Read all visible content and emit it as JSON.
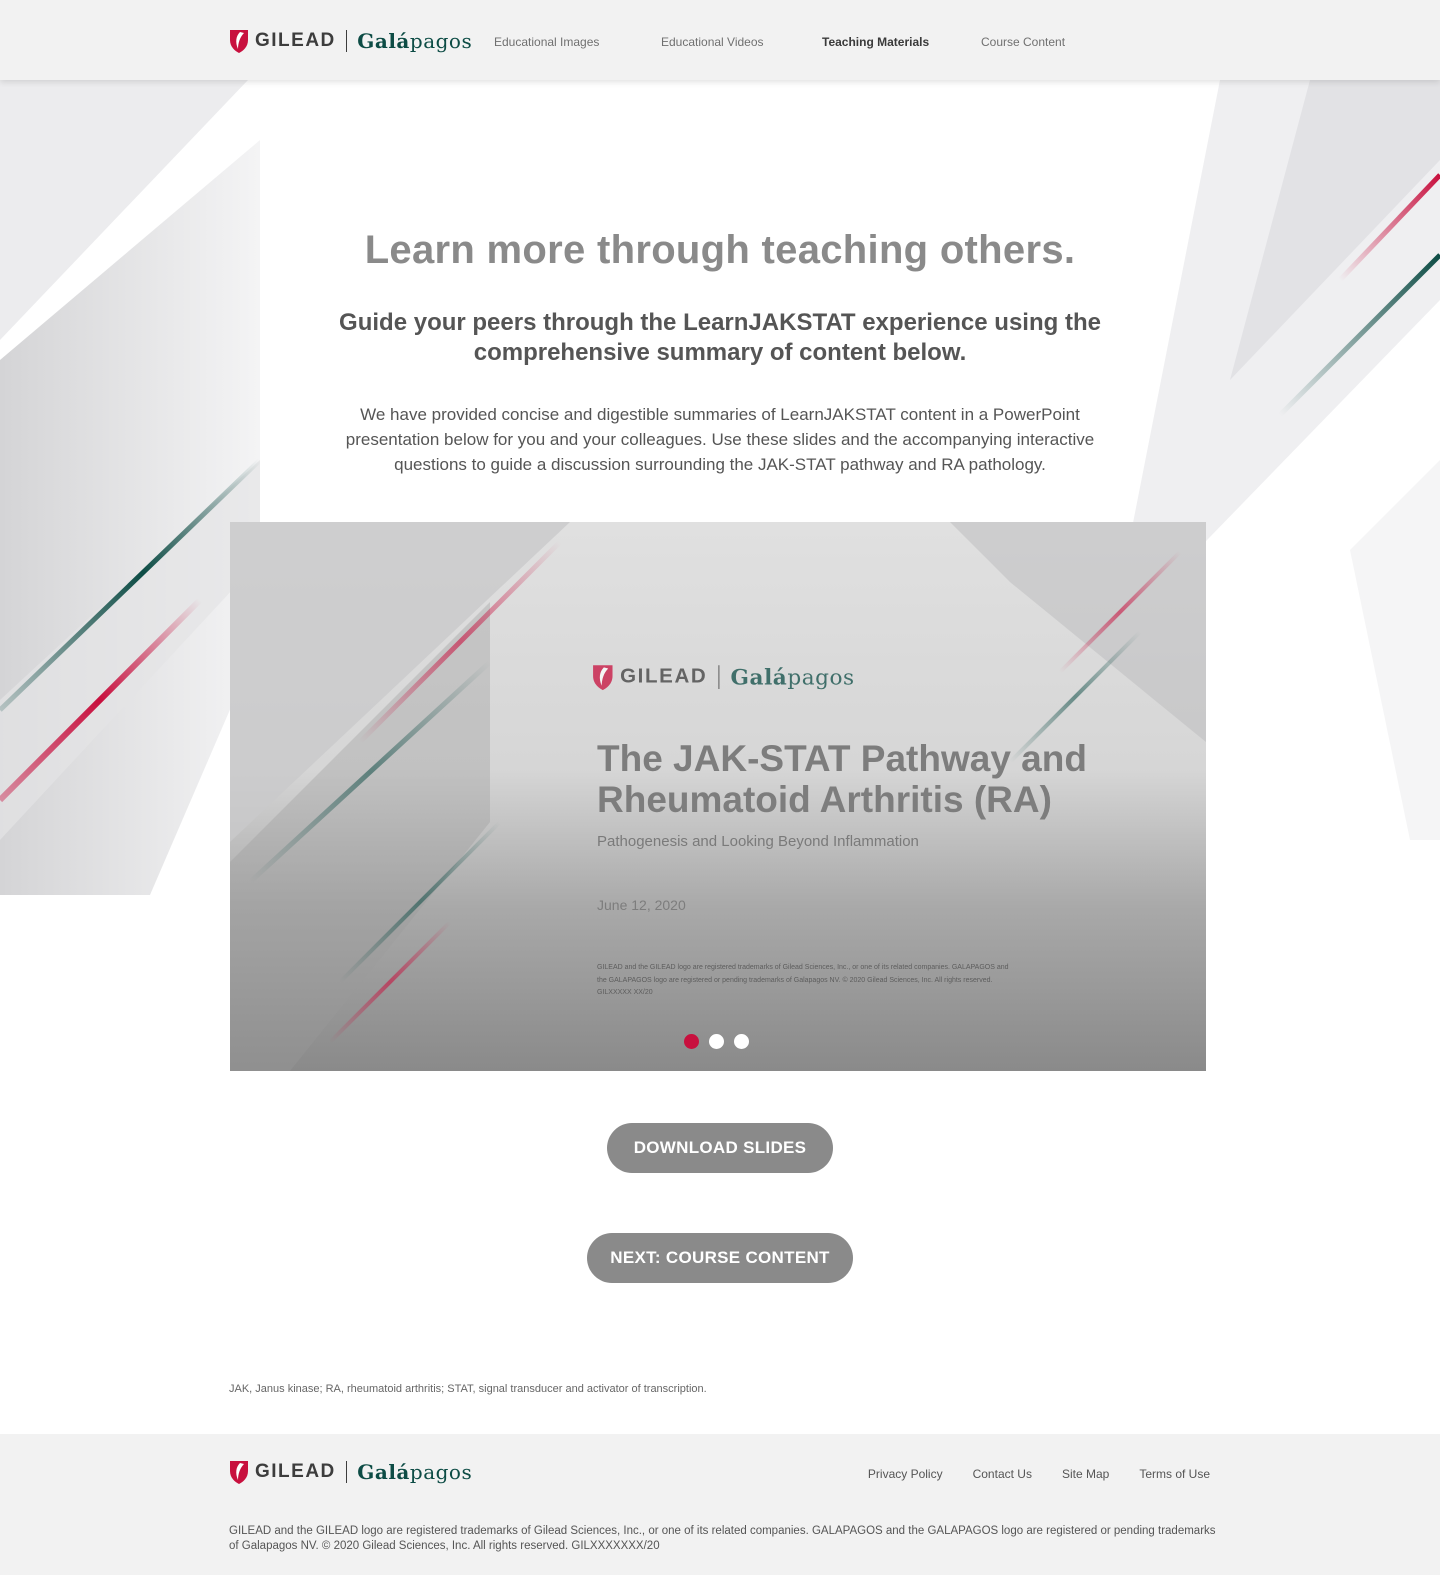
{
  "brand": {
    "gilead": "GILEAD",
    "galapagos_prefix": "Galá",
    "galapagos_suffix": "pagos",
    "colors": {
      "gilead_red": "#c8103e",
      "galapagos_green": "#0d4c45",
      "button_gray": "#8a8a8a"
    }
  },
  "nav": {
    "items": [
      {
        "label": "Educational Images",
        "active": false
      },
      {
        "label": "Educational Videos",
        "active": false
      },
      {
        "label": "Teaching Materials",
        "active": true
      },
      {
        "label": "Course Content",
        "active": false
      }
    ]
  },
  "hero": {
    "title": "Learn more through teaching others.",
    "subtitle": "Guide your peers through the LearnJAKSTAT experience using the comprehensive summary of content below.",
    "body": "We have provided concise and digestible summaries of LearnJAKSTAT content in a PowerPoint presentation below for you and your colleagues. Use these slides and the accompanying interactive questions to guide a discussion surrounding the JAK-STAT pathway and RA pathology."
  },
  "slide": {
    "title": "The JAK-STAT Pathway and Rheumatoid Arthritis (RA)",
    "subtitle": "Pathogenesis and Looking Beyond Inflammation",
    "date": "June 12, 2020",
    "legal": "GILEAD and the GILEAD logo are registered trademarks of Gilead Sciences, Inc., or one of its related companies. GALAPAGOS and the GALAPAGOS logo are registered or pending trademarks of Galapagos NV. © 2020 Gilead Sciences, Inc. All rights reserved. GILXXXXX XX/20",
    "current_index": 1,
    "total": 3
  },
  "buttons": {
    "download": "DOWNLOAD SLIDES",
    "next": "NEXT: COURSE CONTENT"
  },
  "abbreviations": "JAK, Janus kinase; RA, rheumatoid arthritis; STAT, signal transducer and activator of transcription.",
  "footer": {
    "links": [
      "Privacy Policy",
      "Contact Us",
      "Site Map",
      "Terms of Use"
    ],
    "legal": "GILEAD and the GILEAD logo are registered trademarks of Gilead Sciences, Inc., or one of its related companies. GALAPAGOS and the GALAPAGOS logo are registered or pending trademarks of Galapagos NV. © 2020 Gilead Sciences, Inc. All rights reserved. GILXXXXXXX/20"
  }
}
